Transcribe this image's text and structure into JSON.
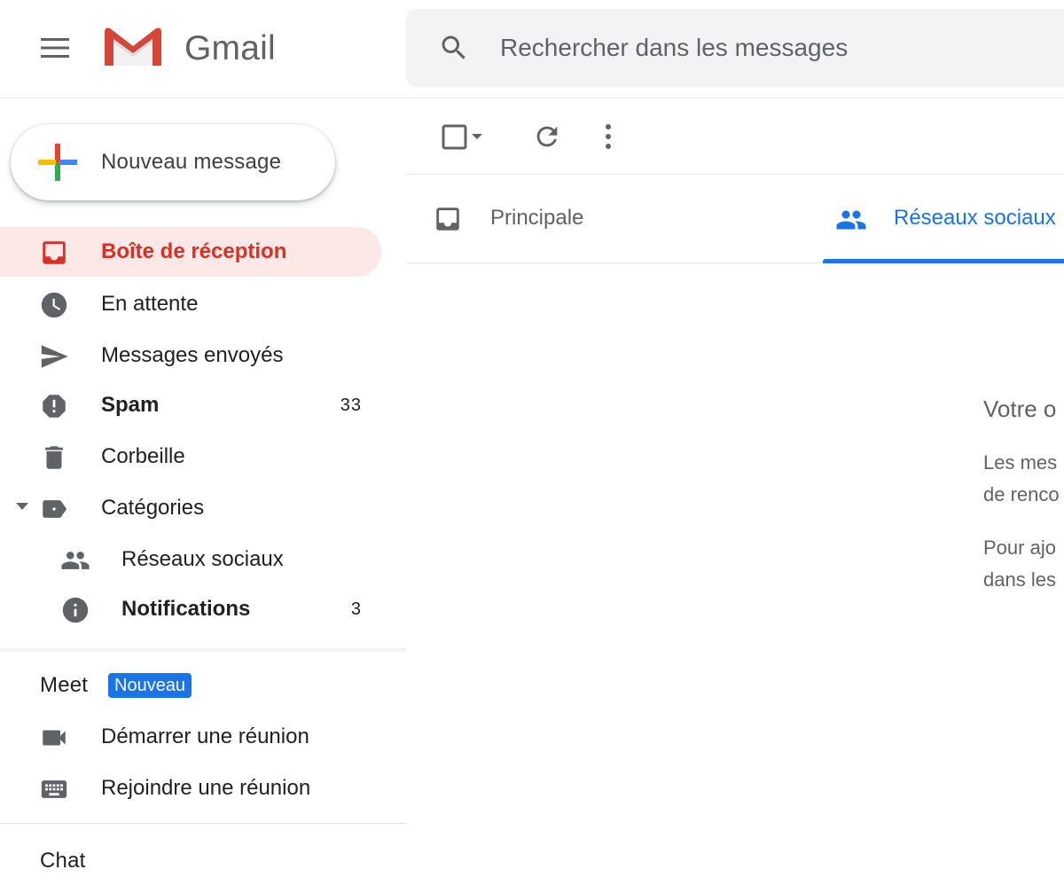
{
  "header": {
    "brand": "Gmail",
    "search_placeholder": "Rechercher dans les messages"
  },
  "sidebar": {
    "compose_label": "Nouveau message",
    "items": [
      {
        "label": "Boîte de réception",
        "icon": "inbox-icon",
        "active": true
      },
      {
        "label": "En attente",
        "icon": "clock-icon"
      },
      {
        "label": "Messages envoyés",
        "icon": "send-icon"
      },
      {
        "label": "Spam",
        "icon": "spam-icon",
        "count": "33",
        "bold": true
      },
      {
        "label": "Corbeille",
        "icon": "trash-icon"
      },
      {
        "label": "Catégories",
        "icon": "label-icon"
      },
      {
        "label": "Réseaux sociaux",
        "icon": "people-icon"
      },
      {
        "label": "Notifications",
        "icon": "info-icon",
        "count": "3",
        "bold": true
      }
    ]
  },
  "meet": {
    "title": "Meet",
    "badge": "Nouveau",
    "items": [
      {
        "label": "Démarrer une réunion",
        "icon": "video-icon"
      },
      {
        "label": "Rejoindre une réunion",
        "icon": "keyboard-icon"
      }
    ]
  },
  "chat": {
    "title": "Chat"
  },
  "tabs": [
    {
      "label": "Principale",
      "icon": "inbox-icon"
    },
    {
      "label": "Réseaux sociaux",
      "icon": "people-icon",
      "active": true
    }
  ],
  "empty_state": {
    "title": "Votre o",
    "line1": "Les mes",
    "line2": "de renco",
    "line3": "Pour ajo",
    "line4": "dans les"
  },
  "colors": {
    "accent_red": "#d93025",
    "active_bg": "#fce8e6",
    "accent_blue": "#1a73e8",
    "icon_grey": "#5f6368"
  }
}
